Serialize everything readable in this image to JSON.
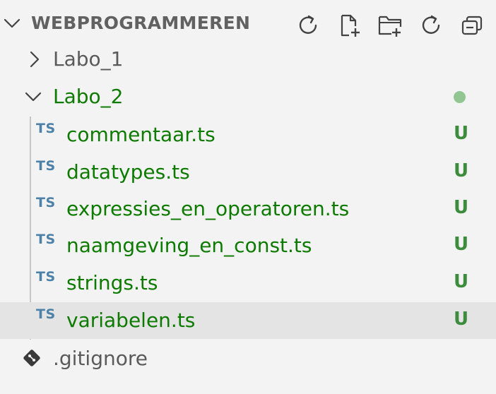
{
  "header": {
    "title": "WEBPROGRAMMEREN",
    "icons": [
      "refresh-icon",
      "new-file-icon",
      "new-folder-icon",
      "refresh-icon",
      "collapse-all-icon"
    ]
  },
  "tree": {
    "labo1": {
      "label": "Labo_1",
      "expanded": false
    },
    "labo2": {
      "label": "Labo_2",
      "expanded": true,
      "status": "modified-dot"
    },
    "files": [
      {
        "icon_text": "TS",
        "label": "commentaar.ts",
        "status": "U"
      },
      {
        "icon_text": "TS",
        "label": "datatypes.ts",
        "status": "U"
      },
      {
        "icon_text": "TS",
        "label": "expressies_en_operatoren.ts",
        "status": "U"
      },
      {
        "icon_text": "TS",
        "label": "naamgeving_en_const.ts",
        "status": "U"
      },
      {
        "icon_text": "TS",
        "label": "strings.ts",
        "status": "U"
      },
      {
        "icon_text": "TS",
        "label": "variabelen.ts",
        "status": "U",
        "selected": true
      }
    ],
    "gitignore": {
      "label": ".gitignore"
    }
  },
  "colors": {
    "background": "#f3f3f3",
    "untracked_green": "#0d7a00",
    "status_green": "#3d8c3d",
    "ts_blue": "#4e81a8",
    "selection": "#e4e4e4"
  }
}
